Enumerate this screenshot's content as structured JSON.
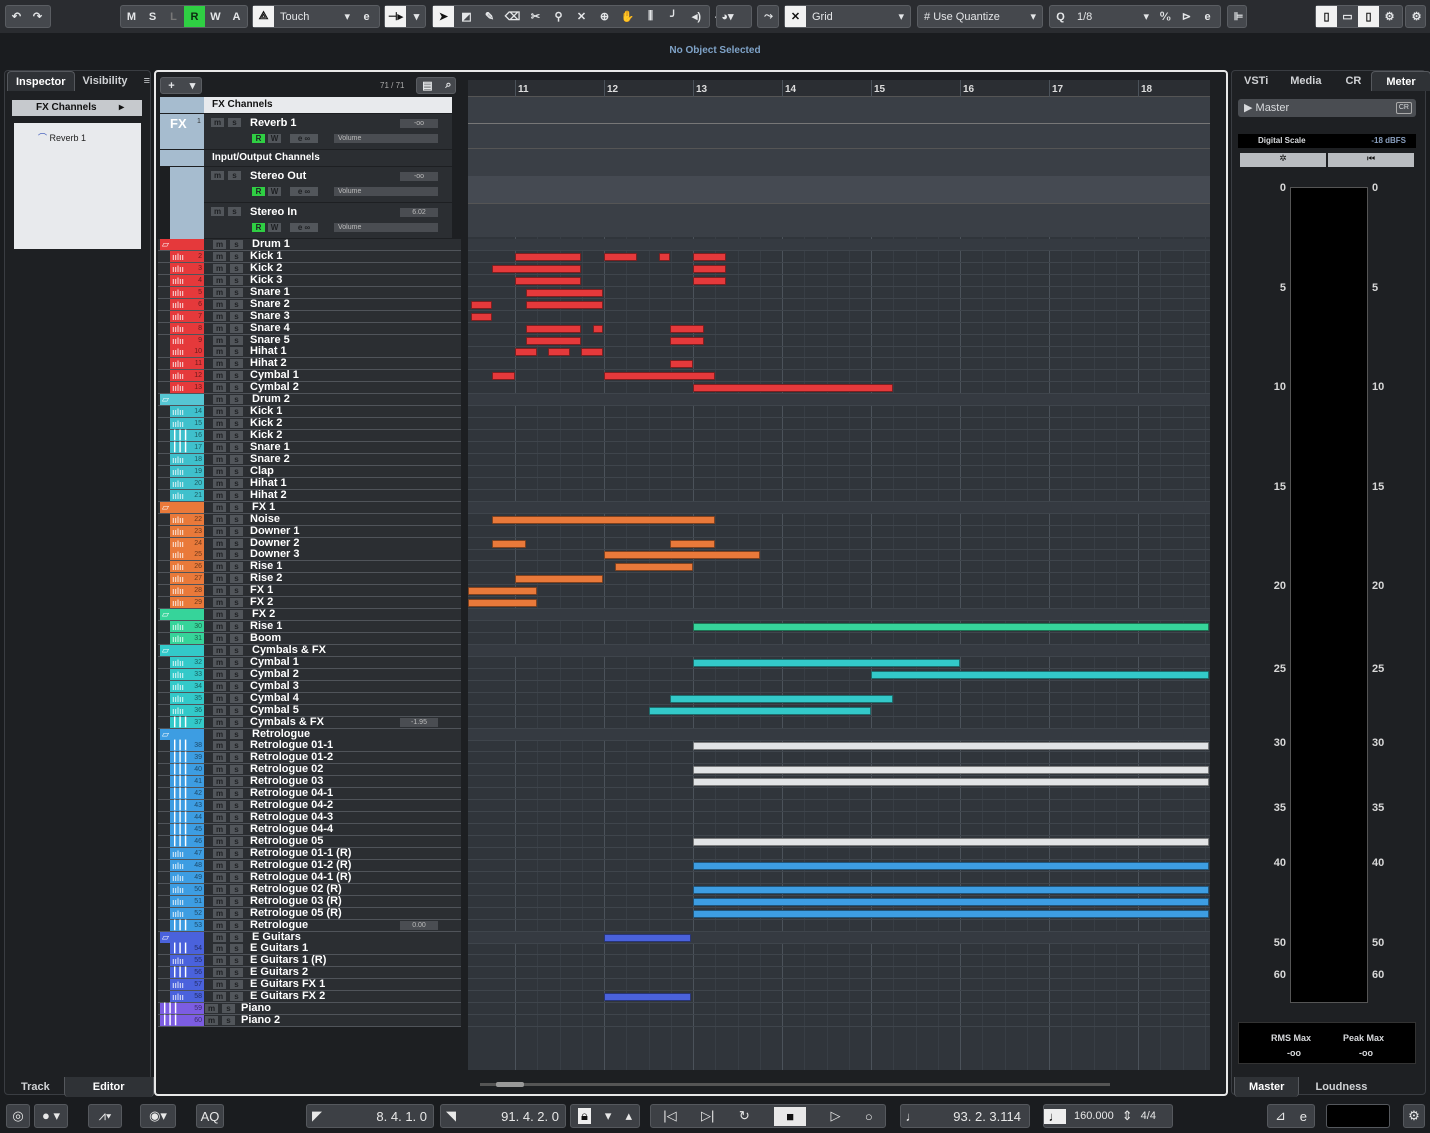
{
  "toolbar": {
    "undo": "↶",
    "redo": "↷",
    "modes": [
      "M",
      "S",
      "L",
      "R",
      "W",
      "A"
    ],
    "automation_mode": "Touch",
    "snap_type": "Grid",
    "quantize_mode": "Use Quantize",
    "quantize_value": "1/8",
    "quantize_label": "Q"
  },
  "info_line": "No Object Selected",
  "inspector": {
    "tabs": [
      "Inspector",
      "Visibility"
    ],
    "section": "FX Channels",
    "tree_item": "Reverb 1",
    "bottom_tabs": [
      "Track",
      "Editor"
    ]
  },
  "tracklist": {
    "count": "71 / 71",
    "fx_folder": "FX Channels",
    "fx_label": "FX",
    "fx_num": "1",
    "io_folder": "Input/Output Channels",
    "top_tracks": [
      {
        "name": "Reverb 1",
        "value": "-oo",
        "param": "Volume"
      },
      {
        "name": "Stereo Out",
        "value": "-oo",
        "param": "Volume"
      },
      {
        "name": "Stereo In",
        "value": "6.02",
        "param": "Volume"
      }
    ],
    "rw": [
      "R",
      "W"
    ],
    "tracks": [
      {
        "name": "Drum 1",
        "folder": true,
        "color": "#e5393b"
      },
      {
        "name": "Kick 1",
        "num": "2",
        "color": "#e5393b",
        "clips": [
          [
            11,
            11.74
          ],
          [
            12,
            12.37
          ],
          [
            12.62,
            12.74
          ],
          [
            13,
            13.37
          ]
        ]
      },
      {
        "name": "Kick 2",
        "num": "3",
        "color": "#e5393b",
        "clips": [
          [
            10.74,
            11.74
          ],
          [
            13,
            13.37
          ]
        ]
      },
      {
        "name": "Kick 3",
        "num": "4",
        "color": "#e5393b",
        "clips": [
          [
            11,
            11.74
          ],
          [
            13,
            13.37
          ]
        ]
      },
      {
        "name": "Snare 1",
        "num": "5",
        "color": "#e5393b",
        "clips": [
          [
            11.12,
            11.99
          ]
        ]
      },
      {
        "name": "Snare 2",
        "num": "6",
        "color": "#e5393b",
        "clips": [
          [
            10.5,
            10.74
          ],
          [
            11.12,
            11.99
          ]
        ]
      },
      {
        "name": "Snare 3",
        "num": "7",
        "color": "#e5393b",
        "clips": [
          [
            10.5,
            10.74
          ]
        ]
      },
      {
        "name": "Snare 4",
        "num": "8",
        "color": "#e5393b",
        "clips": [
          [
            11.12,
            11.74
          ],
          [
            11.88,
            11.99
          ],
          [
            12.74,
            13.12
          ]
        ]
      },
      {
        "name": "Snare 5",
        "num": "9",
        "color": "#e5393b",
        "clips": [
          [
            11.12,
            11.74
          ],
          [
            12.74,
            13.12
          ]
        ]
      },
      {
        "name": "Hihat 1",
        "num": "10",
        "color": "#e5393b",
        "clips": [
          [
            11,
            11.25
          ],
          [
            11.37,
            11.62
          ],
          [
            11.74,
            11.99
          ]
        ]
      },
      {
        "name": "Hihat 2",
        "num": "11",
        "color": "#e5393b",
        "clips": [
          [
            12.74,
            13
          ]
        ]
      },
      {
        "name": "Cymbal 1",
        "num": "12",
        "color": "#e5393b",
        "clips": [
          [
            10.74,
            11
          ],
          [
            12,
            13.25
          ]
        ]
      },
      {
        "name": "Cymbal 2",
        "num": "13",
        "color": "#e5393b",
        "clips": [
          [
            13,
            15.25
          ]
        ]
      },
      {
        "name": "Drum 2",
        "folder": true,
        "color": "#56c6d3"
      },
      {
        "name": "Kick 1",
        "num": "14",
        "color": "#3fc0cc"
      },
      {
        "name": "Kick 2",
        "num": "15",
        "color": "#3fc0cc"
      },
      {
        "name": "Kick 2",
        "num": "16",
        "color": "#3fc0cc",
        "inst": true
      },
      {
        "name": "Snare 1",
        "num": "17",
        "color": "#3fc0cc",
        "inst": true
      },
      {
        "name": "Snare 2",
        "num": "18",
        "color": "#3fc0cc"
      },
      {
        "name": "Clap",
        "num": "19",
        "color": "#3fc0cc"
      },
      {
        "name": "Hihat 1",
        "num": "20",
        "color": "#3fc0cc"
      },
      {
        "name": "Hihat 2",
        "num": "21",
        "color": "#3fc0cc"
      },
      {
        "name": "FX 1",
        "folder": true,
        "color": "#e9793a"
      },
      {
        "name": "Noise",
        "num": "22",
        "color": "#e9793a",
        "clips": [
          [
            10.74,
            13.25
          ]
        ]
      },
      {
        "name": "Downer 1",
        "num": "23",
        "color": "#e9793a"
      },
      {
        "name": "Downer 2",
        "num": "24",
        "color": "#e9793a",
        "clips": [
          [
            10.74,
            11.12
          ],
          [
            12.74,
            13.25
          ]
        ]
      },
      {
        "name": "Downer 3",
        "num": "25",
        "color": "#e9793a",
        "clips": [
          [
            12,
            13.75
          ]
        ]
      },
      {
        "name": "Rise 1",
        "num": "26",
        "color": "#e9793a",
        "clips": [
          [
            12.12,
            13
          ]
        ]
      },
      {
        "name": "Rise 2",
        "num": "27",
        "color": "#e9793a",
        "clips": [
          [
            11,
            11.99
          ]
        ]
      },
      {
        "name": "FX 1",
        "num": "28",
        "color": "#e9793a",
        "clips": [
          [
            10.47,
            11.25
          ]
        ]
      },
      {
        "name": "FX 2",
        "num": "29",
        "color": "#e9793a",
        "clips": [
          [
            10.47,
            11.25
          ]
        ]
      },
      {
        "name": "FX 2",
        "folder": true,
        "color": "#36d49a"
      },
      {
        "name": "Rise 1",
        "num": "30",
        "color": "#36d49a",
        "clips": [
          [
            13,
            18.8
          ]
        ]
      },
      {
        "name": "Boom",
        "num": "31",
        "color": "#36d49a"
      },
      {
        "name": "Cymbals & FX",
        "folder": true,
        "color": "#33c9c9"
      },
      {
        "name": "Cymbal 1",
        "num": "32",
        "color": "#33c9c9",
        "clips": [
          [
            13,
            16
          ]
        ]
      },
      {
        "name": "Cymbal 2",
        "num": "33",
        "color": "#33c9c9",
        "clips": [
          [
            15,
            18.8
          ]
        ]
      },
      {
        "name": "Cymbal 3",
        "num": "34",
        "color": "#33c9c9"
      },
      {
        "name": "Cymbal 4",
        "num": "35",
        "color": "#33c9c9",
        "clips": [
          [
            12.74,
            15.25
          ]
        ]
      },
      {
        "name": "Cymbal 5",
        "num": "36",
        "color": "#33c9c9",
        "clips": [
          [
            12.5,
            15
          ]
        ]
      },
      {
        "name": "Cymbals & FX",
        "num": "37",
        "color": "#33c9c9",
        "group": true,
        "value": "-1.95"
      },
      {
        "name": "Retrologue",
        "folder": true,
        "color": "#3d9de2"
      },
      {
        "name": "Retrologue 01-1",
        "num": "38",
        "color": "#3d9de2",
        "inst": true,
        "clipcolor": "#e2e4e6",
        "clips": [
          [
            13,
            18.8
          ]
        ]
      },
      {
        "name": "Retrologue 01-2",
        "num": "39",
        "color": "#3d9de2",
        "inst": true
      },
      {
        "name": "Retrologue 02",
        "num": "40",
        "color": "#3d9de2",
        "inst": true,
        "clipcolor": "#e2e4e6",
        "clips": [
          [
            13,
            18.8
          ]
        ]
      },
      {
        "name": "Retrologue 03",
        "num": "41",
        "color": "#3d9de2",
        "inst": true,
        "clipcolor": "#e2e4e6",
        "clips": [
          [
            13,
            18.8
          ]
        ]
      },
      {
        "name": "Retrologue 04-1",
        "num": "42",
        "color": "#3d9de2",
        "inst": true
      },
      {
        "name": "Retrologue 04-2",
        "num": "43",
        "color": "#3d9de2",
        "inst": true
      },
      {
        "name": "Retrologue 04-3",
        "num": "44",
        "color": "#3d9de2",
        "inst": true
      },
      {
        "name": "Retrologue 04-4",
        "num": "45",
        "color": "#3d9de2",
        "inst": true
      },
      {
        "name": "Retrologue 05",
        "num": "46",
        "color": "#3d9de2",
        "inst": true,
        "clipcolor": "#e2e4e6",
        "clips": [
          [
            13,
            18.8
          ]
        ]
      },
      {
        "name": "Retrologue 01-1 (R)",
        "num": "47",
        "color": "#3d9de2"
      },
      {
        "name": "Retrologue 01-2 (R)",
        "num": "48",
        "color": "#3d9de2",
        "clips": [
          [
            13,
            18.8
          ]
        ]
      },
      {
        "name": "Retrologue 04-1 (R)",
        "num": "49",
        "color": "#3d9de2"
      },
      {
        "name": "Retrologue 02 (R)",
        "num": "50",
        "color": "#3d9de2",
        "clips": [
          [
            13,
            18.8
          ]
        ]
      },
      {
        "name": "Retrologue 03 (R)",
        "num": "51",
        "color": "#3d9de2",
        "clips": [
          [
            13,
            18.8
          ]
        ]
      },
      {
        "name": "Retrologue 05 (R)",
        "num": "52",
        "color": "#3d9de2",
        "clips": [
          [
            13,
            18.8
          ]
        ]
      },
      {
        "name": "Retrologue",
        "num": "53",
        "color": "#3d9de2",
        "group": true,
        "value": "0.00"
      },
      {
        "name": "E Guitars",
        "folder": true,
        "color": "#4a62dc",
        "clips": [
          [
            12,
            12.98
          ]
        ]
      },
      {
        "name": "E Guitars 1",
        "num": "54",
        "color": "#4a62dc",
        "inst": true
      },
      {
        "name": "E Guitars 1 (R)",
        "num": "55",
        "color": "#4a62dc"
      },
      {
        "name": "E Guitars 2",
        "num": "56",
        "color": "#4a62dc",
        "inst": true
      },
      {
        "name": "E Guitars FX 1",
        "num": "57",
        "color": "#4a62dc"
      },
      {
        "name": "E Guitars FX 2",
        "num": "58",
        "color": "#4a62dc",
        "clips": [
          [
            12,
            12.98
          ]
        ]
      },
      {
        "name": "Piano",
        "num": "59",
        "color": "#7c5de2",
        "inst": true,
        "top": true
      },
      {
        "name": "Piano 2",
        "num": "60",
        "color": "#7c5de2",
        "inst": true,
        "top": true
      }
    ]
  },
  "ruler": {
    "bars": [
      "11",
      "12",
      "13",
      "14",
      "15",
      "16",
      "17",
      "18"
    ]
  },
  "right": {
    "tabs": [
      "VSTi",
      "Media",
      "CR",
      "Meter"
    ],
    "master": "Master",
    "cr_badge": "CR",
    "scale": "Digital Scale",
    "scale_value": "-18 dBFS",
    "meter_labels": [
      "0",
      "5",
      "10",
      "15",
      "20",
      "25",
      "30",
      "35",
      "40",
      "50",
      "60"
    ],
    "rms_label": "RMS Max",
    "rms_value": "-oo",
    "peak_label": "Peak Max",
    "peak_value": "-oo",
    "bottom_tabs": [
      "Master",
      "Loudness"
    ]
  },
  "transport": {
    "left_locator": "8. 4. 1.   0",
    "right_locator": "91. 4. 2.   0",
    "position": "93. 2. 3.114",
    "tempo": "160.000",
    "signature": "4/4",
    "aq": "AQ"
  }
}
